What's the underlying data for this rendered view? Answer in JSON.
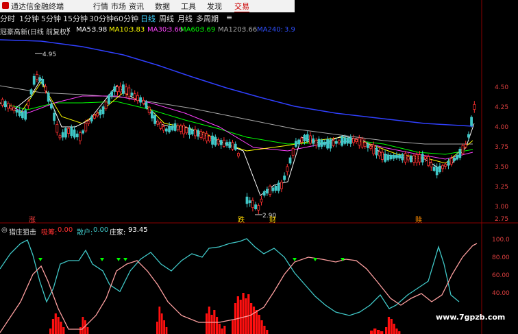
{
  "titlebar": {
    "app_title": "通达信金融终端",
    "menus": [
      "行情",
      "市场",
      "资讯",
      "数据",
      "工具",
      "发现",
      "交易"
    ],
    "active_menu": "交易"
  },
  "periods": {
    "items": [
      "分时",
      "1分钟",
      "5分钟",
      "15分钟",
      "30分钟",
      "60分钟",
      "日线",
      "周线",
      "月线",
      "多周期"
    ],
    "active": "日线",
    "more": "≡"
  },
  "stock_header": {
    "name": "冠豪高新(日线 前复权)",
    "close_icon": "x"
  },
  "ma": [
    {
      "label": "MA5:",
      "value": "3.98",
      "color": "#ffffff"
    },
    {
      "label": "MA10:",
      "value": "3.83",
      "color": "#ffff00"
    },
    {
      "label": "MA30:",
      "value": "3.66",
      "color": "#ff40ff"
    },
    {
      "label": "MA60:",
      "value": "3.69",
      "color": "#00ff00"
    },
    {
      "label": "MA120:",
      "value": "3.66",
      "color": "#aaaaaa"
    },
    {
      "label": "MA240:",
      "value": "3.9",
      "color": "#3050ff"
    }
  ],
  "price_axis": [
    "4.50",
    "4.25",
    "4.00",
    "3.75",
    "3.50",
    "3.25",
    "3.00",
    "2.75"
  ],
  "annotations": {
    "high": "4.95",
    "low": "2.90"
  },
  "signals": [
    "涨",
    "跌",
    "财",
    "赎"
  ],
  "indicator": {
    "name": "猎庄狙击",
    "items": [
      {
        "label": "吸筹:",
        "value": "0.00",
        "color": "#ff3030"
      },
      {
        "label": "散户:",
        "value": "0.00",
        "color": "#40c8c8"
      },
      {
        "label": "庄家:",
        "value": "93.45",
        "color": "#ffffff"
      }
    ],
    "axis": [
      "100.0",
      "80.00",
      "60.00",
      "40.00"
    ]
  },
  "watermark": "www.7gpzb.com",
  "colors": {
    "up": "#ff3030",
    "down": "#40c8c8",
    "ma240": "#3040ff",
    "background": "#000000"
  }
}
